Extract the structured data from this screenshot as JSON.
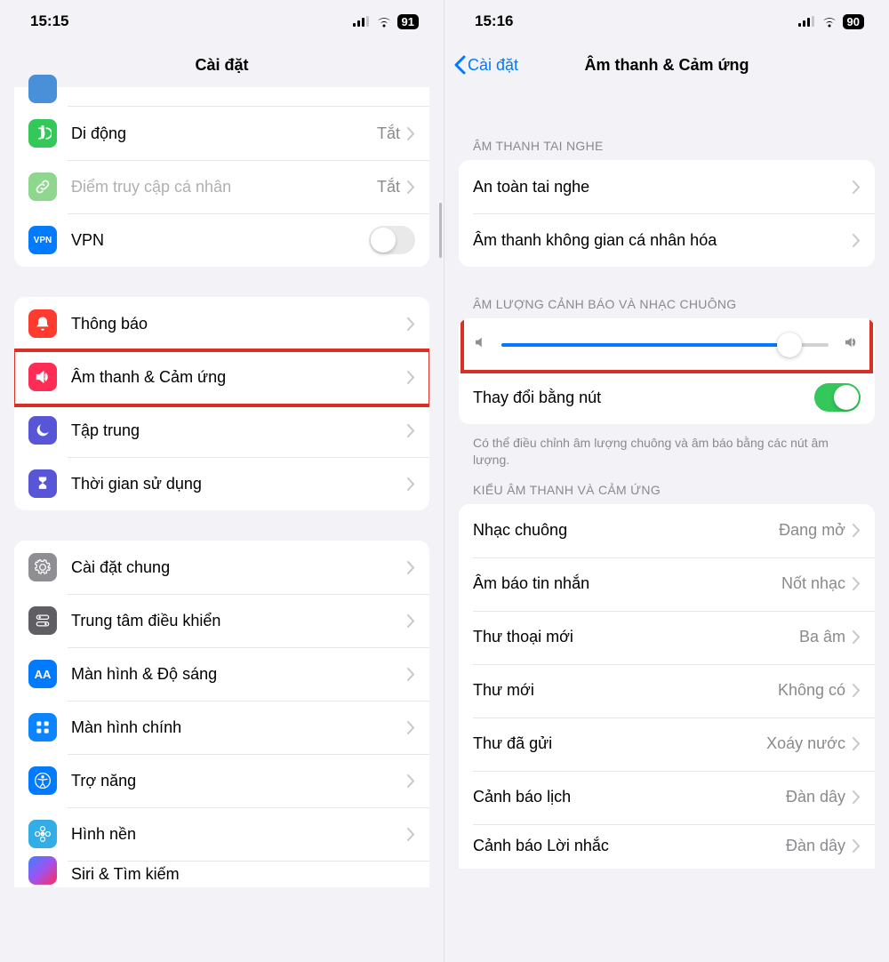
{
  "left": {
    "status": {
      "time": "15:15",
      "battery": "91"
    },
    "title": "Cài đặt",
    "groups": [
      {
        "rows": [
          {
            "label": "Di động",
            "value": "Tắt"
          },
          {
            "label": "Điểm truy cập cá nhân",
            "value": "Tắt"
          },
          {
            "label": "VPN",
            "vpn_badge": "VPN"
          }
        ]
      },
      {
        "rows": [
          {
            "label": "Thông báo"
          },
          {
            "label": "Âm thanh & Cảm ứng"
          },
          {
            "label": "Tập trung"
          },
          {
            "label": "Thời gian sử dụng"
          }
        ]
      },
      {
        "rows": [
          {
            "label": "Cài đặt chung"
          },
          {
            "label": "Trung tâm điều khiển"
          },
          {
            "label": "Màn hình & Độ sáng"
          },
          {
            "label": "Màn hình chính"
          },
          {
            "label": "Trợ năng"
          },
          {
            "label": "Hình nền"
          },
          {
            "label": "Siri & Tìm kiếm"
          }
        ]
      }
    ]
  },
  "right": {
    "status": {
      "time": "15:16",
      "battery": "90"
    },
    "back": "Cài đặt",
    "title": "Âm thanh & Cảm ứng",
    "section1_header": "ÂM THANH TAI NGHE",
    "section1": {
      "rows": [
        {
          "label": "An toàn tai nghe"
        },
        {
          "label": "Âm thanh không gian cá nhân hóa"
        }
      ]
    },
    "section2_header": "ÂM LƯỢNG CẢNH BÁO VÀ NHẠC CHUÔNG",
    "slider_percent": 88,
    "change_with_buttons": "Thay đổi bằng nút",
    "section2_note": "Có thể điều chỉnh âm lượng chuông và âm báo bằng các nút âm lượng.",
    "section3_header": "KIỂU ÂM THANH VÀ CẢM ỨNG",
    "section3": {
      "rows": [
        {
          "label": "Nhạc chuông",
          "value": "Đang mở"
        },
        {
          "label": "Âm báo tin nhắn",
          "value": "Nốt nhạc"
        },
        {
          "label": "Thư thoại mới",
          "value": "Ba âm"
        },
        {
          "label": "Thư mới",
          "value": "Không có"
        },
        {
          "label": "Thư đã gửi",
          "value": "Xoáy nước"
        },
        {
          "label": "Cảnh báo lịch",
          "value": "Đàn dây"
        },
        {
          "label": "Cảnh báo Lời nhắc",
          "value": "Đàn dây"
        }
      ]
    }
  }
}
